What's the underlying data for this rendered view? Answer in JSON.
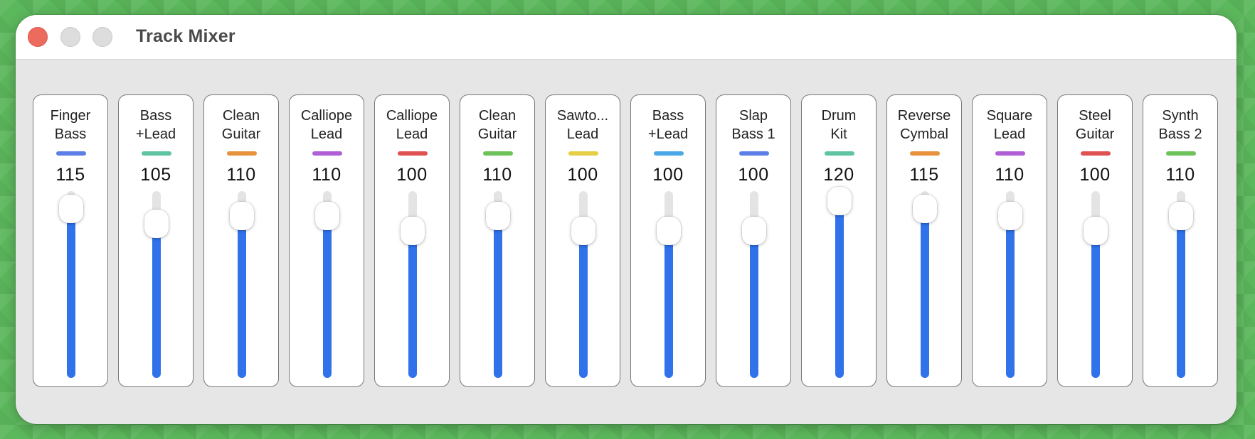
{
  "window": {
    "title": "Track Mixer"
  },
  "controls": {
    "close": "close",
    "minimize": "minimize",
    "zoom": "zoom"
  },
  "volume_max": 127,
  "tracks": [
    {
      "name": "Finger\nBass",
      "color": "#5b7fe6",
      "volume": "115",
      "level": 115
    },
    {
      "name": "Bass\n+Lead",
      "color": "#5ec4a3",
      "volume": "105",
      "level": 105
    },
    {
      "name": "Clean\nGuitar",
      "color": "#e8923f",
      "volume": "110",
      "level": 110
    },
    {
      "name": "Calliope\nLead",
      "color": "#b05fd6",
      "volume": "110",
      "level": 110
    },
    {
      "name": "Calliope\nLead",
      "color": "#e05252",
      "volume": "100",
      "level": 100
    },
    {
      "name": "Clean\nGuitar",
      "color": "#6cc35a",
      "volume": "110",
      "level": 110
    },
    {
      "name": "Sawto...\nLead",
      "color": "#e6cf45",
      "volume": "100",
      "level": 100
    },
    {
      "name": "Bass\n+Lead",
      "color": "#4aa8e8",
      "volume": "100",
      "level": 100
    },
    {
      "name": "Slap\nBass 1",
      "color": "#5b7fe6",
      "volume": "100",
      "level": 100
    },
    {
      "name": "Drum\nKit",
      "color": "#5ec4a3",
      "volume": "120",
      "level": 120
    },
    {
      "name": "Reverse\nCymbal",
      "color": "#e8923f",
      "volume": "115",
      "level": 115
    },
    {
      "name": "Square\nLead",
      "color": "#b05fd6",
      "volume": "110",
      "level": 110
    },
    {
      "name": "Steel\nGuitar",
      "color": "#e05252",
      "volume": "100",
      "level": 100
    },
    {
      "name": "Synth\nBass 2",
      "color": "#6cc35a",
      "volume": "110",
      "level": 110
    }
  ]
}
